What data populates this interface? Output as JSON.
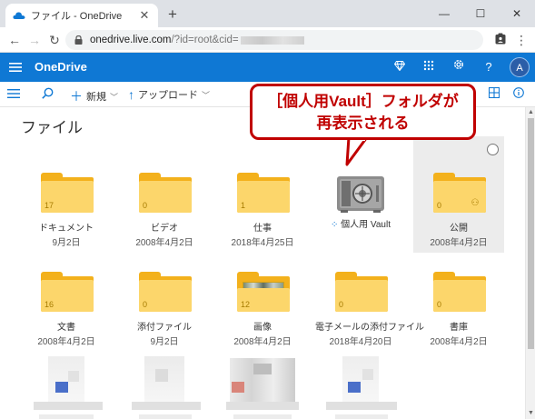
{
  "browser": {
    "tab_title": "ファイル - OneDrive",
    "tab_close": "✕",
    "new_tab": "+",
    "window_controls": [
      "—",
      "☐",
      "✕"
    ],
    "url_host": "onedrive.live.com",
    "url_path": "/?id=root&cid="
  },
  "header": {
    "brand": "OneDrive",
    "help": "?",
    "avatar": "A"
  },
  "commandbar": {
    "new_label": "新規",
    "upload_label": "アップロード"
  },
  "page_title": "ファイル",
  "callout": {
    "line1": "［個人用Vault］フォルダが",
    "line2": "再表示される"
  },
  "items_row1": [
    {
      "name": "ドキュメント",
      "date": "9月2日",
      "count": "17",
      "type": "folder"
    },
    {
      "name": "ビデオ",
      "date": "2008年4月2日",
      "count": "0",
      "type": "folder"
    },
    {
      "name": "仕事",
      "date": "2018年4月25日",
      "count": "1",
      "type": "folder"
    },
    {
      "name": "個人用 Vault",
      "date": "",
      "count": "",
      "type": "vault"
    },
    {
      "name": "公開",
      "date": "2008年4月2日",
      "count": "0",
      "type": "shared-folder"
    }
  ],
  "items_row2": [
    {
      "name": "文書",
      "date": "2008年4月2日",
      "count": "16",
      "type": "folder"
    },
    {
      "name": "添付ファイル",
      "date": "9月2日",
      "count": "0",
      "type": "folder"
    },
    {
      "name": "画像",
      "date": "2008年4月2日",
      "count": "12",
      "type": "image-folder"
    },
    {
      "name": "電子メールの添付ファイル",
      "date": "2018年4月20日",
      "count": "0",
      "type": "folder"
    },
    {
      "name": "書庫",
      "date": "2008年4月2日",
      "count": "0",
      "type": "folder"
    }
  ],
  "colors": {
    "onedrive_blue": "#0f78d4",
    "folder_front": "#fcd66b",
    "folder_back": "#f3b11c",
    "callout_red": "#c00000"
  }
}
